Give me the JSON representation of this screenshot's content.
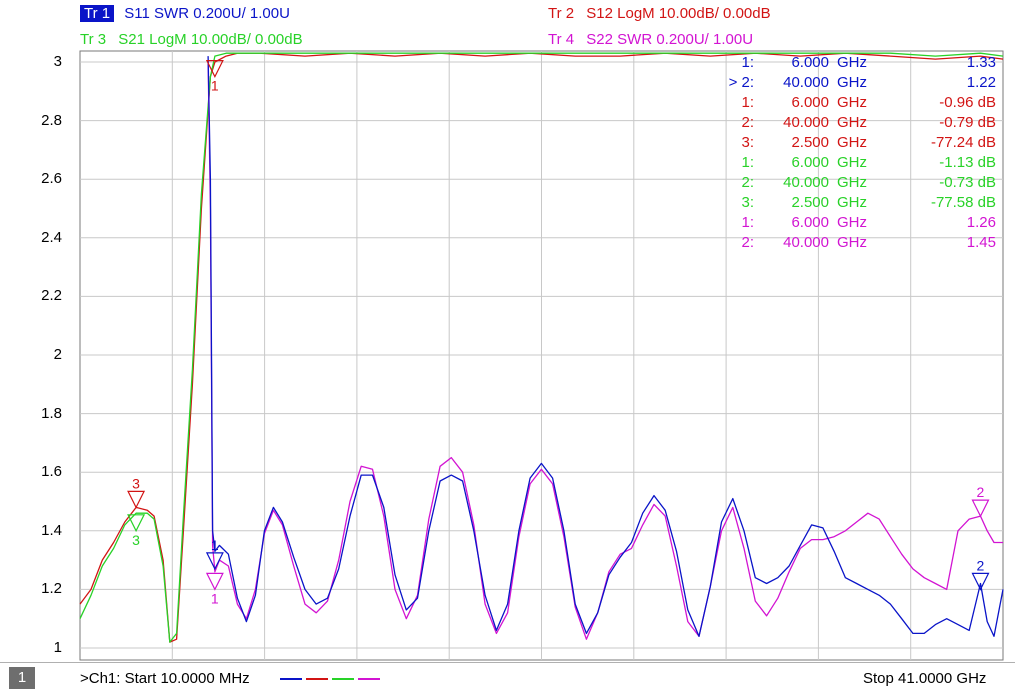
{
  "traces": [
    {
      "id": "tr1",
      "label": "Tr 1",
      "text": "S11 SWR 0.200U/  1.00U",
      "color": "#0a14c8"
    },
    {
      "id": "tr2",
      "label": "Tr 2",
      "text": "S12 LogM 10.00dB/  0.00dB",
      "color": "#d21414"
    },
    {
      "id": "tr3",
      "label": "Tr 3",
      "text": "S21 LogM 10.00dB/  0.00dB",
      "color": "#28d228"
    },
    {
      "id": "tr4",
      "label": "Tr 4",
      "text": "S22 SWR 0.200U/  1.00U",
      "color": "#d214d2"
    }
  ],
  "markers": [
    {
      "prefix": "1:",
      "freq": "6.000",
      "unit": "GHz",
      "value": "1.33",
      "color": "#0a14c8"
    },
    {
      "prefix": "> 2:",
      "freq": "40.000",
      "unit": "GHz",
      "value": "1.22",
      "color": "#0a14c8"
    },
    {
      "prefix": "1:",
      "freq": "6.000",
      "unit": "GHz",
      "value": "-0.96 dB",
      "color": "#d21414"
    },
    {
      "prefix": "2:",
      "freq": "40.000",
      "unit": "GHz",
      "value": "-0.79 dB",
      "color": "#d21414"
    },
    {
      "prefix": "3:",
      "freq": "2.500",
      "unit": "GHz",
      "value": "-77.24 dB",
      "color": "#d21414"
    },
    {
      "prefix": "1:",
      "freq": "6.000",
      "unit": "GHz",
      "value": "-1.13 dB",
      "color": "#28d228"
    },
    {
      "prefix": "2:",
      "freq": "40.000",
      "unit": "GHz",
      "value": "-0.73 dB",
      "color": "#28d228"
    },
    {
      "prefix": "3:",
      "freq": "2.500",
      "unit": "GHz",
      "value": "-77.58 dB",
      "color": "#28d228"
    },
    {
      "prefix": "1:",
      "freq": "6.000",
      "unit": "GHz",
      "value": "1.26",
      "color": "#d214d2"
    },
    {
      "prefix": "2:",
      "freq": "40.000",
      "unit": "GHz",
      "value": "1.45",
      "color": "#d214d2"
    }
  ],
  "footer": {
    "channel": "1",
    "start_text": ">Ch1:  Start   10.0000 MHz",
    "stop_text": "Stop  41.0000 GHz",
    "swatch_colors": [
      "#0a14c8",
      "#d21414",
      "#28d228",
      "#d214d2"
    ]
  },
  "chart_data": {
    "type": "line",
    "xlabel": "",
    "ylabel": "",
    "xlim": [
      0.01,
      41.0
    ],
    "ylim": [
      1,
      3
    ],
    "yticks": [
      3,
      2.8,
      2.6,
      2.4,
      2.2,
      2,
      1.8,
      1.6,
      1.4,
      1.2,
      1
    ],
    "ytick_labels": [
      "3",
      "2.8",
      "2.6",
      "2.4",
      "2.2",
      "2",
      "1.8",
      "1.6",
      "1.4",
      "1.2",
      "1"
    ],
    "grid": true,
    "series": [
      {
        "name": "S11 SWR",
        "color": "#0a14c8",
        "x": [
          5.7,
          5.8,
          5.9,
          6.0,
          6.2,
          6.6,
          7.0,
          7.4,
          7.8,
          8.2,
          8.6,
          9.0,
          9.5,
          10,
          10.5,
          11,
          11.5,
          12,
          12.5,
          13,
          13.5,
          14,
          14.5,
          15,
          15.5,
          16,
          16.5,
          17,
          17.5,
          18,
          18.5,
          19,
          19.5,
          20,
          20.5,
          21,
          21.5,
          22,
          22.5,
          23,
          23.5,
          24,
          24.5,
          25,
          25.5,
          26,
          26.5,
          27,
          27.5,
          28,
          28.5,
          29,
          29.5,
          30,
          30.5,
          31,
          31.5,
          32,
          32.5,
          33,
          33.5,
          34,
          34.5,
          35,
          35.5,
          36,
          36.5,
          37,
          37.5,
          38,
          38.5,
          39,
          39.5,
          40,
          40.3,
          40.6,
          41
        ],
        "y": [
          3.02,
          2.6,
          1.4,
          1.33,
          1.35,
          1.32,
          1.17,
          1.09,
          1.18,
          1.4,
          1.48,
          1.43,
          1.31,
          1.2,
          1.15,
          1.17,
          1.27,
          1.45,
          1.59,
          1.59,
          1.48,
          1.25,
          1.13,
          1.17,
          1.4,
          1.57,
          1.59,
          1.57,
          1.4,
          1.18,
          1.06,
          1.15,
          1.4,
          1.58,
          1.63,
          1.58,
          1.4,
          1.15,
          1.05,
          1.12,
          1.25,
          1.31,
          1.36,
          1.46,
          1.52,
          1.47,
          1.33,
          1.13,
          1.04,
          1.21,
          1.43,
          1.51,
          1.4,
          1.24,
          1.22,
          1.24,
          1.28,
          1.35,
          1.42,
          1.41,
          1.33,
          1.24,
          1.22,
          1.2,
          1.18,
          1.15,
          1.1,
          1.05,
          1.05,
          1.08,
          1.1,
          1.08,
          1.06,
          1.22,
          1.09,
          1.04,
          1.2
        ]
      },
      {
        "name": "S22 SWR",
        "color": "#d214d2",
        "x": [
          5.7,
          5.8,
          5.9,
          6.0,
          6.2,
          6.6,
          7.0,
          7.4,
          7.8,
          8.2,
          8.6,
          9.0,
          9.5,
          10,
          10.5,
          11,
          11.5,
          12,
          12.5,
          13,
          13.5,
          14,
          14.5,
          15,
          15.5,
          16,
          16.5,
          17,
          17.5,
          18,
          18.5,
          19,
          19.5,
          20,
          20.5,
          21,
          21.5,
          22,
          22.5,
          23,
          23.5,
          24,
          24.5,
          25,
          25.5,
          26,
          26.5,
          27,
          27.5,
          28,
          28.5,
          29,
          29.5,
          30,
          30.5,
          31,
          31.5,
          32,
          32.5,
          33,
          33.5,
          34,
          34.5,
          35,
          35.5,
          36,
          36.5,
          37,
          37.5,
          38,
          38.5,
          39,
          39.5,
          40,
          40.3,
          40.6,
          41
        ],
        "y": [
          3.0,
          2.5,
          1.35,
          1.26,
          1.3,
          1.28,
          1.15,
          1.1,
          1.2,
          1.39,
          1.47,
          1.42,
          1.28,
          1.15,
          1.12,
          1.16,
          1.3,
          1.5,
          1.62,
          1.61,
          1.45,
          1.2,
          1.1,
          1.18,
          1.44,
          1.62,
          1.65,
          1.6,
          1.42,
          1.15,
          1.05,
          1.12,
          1.38,
          1.56,
          1.61,
          1.56,
          1.38,
          1.14,
          1.03,
          1.12,
          1.26,
          1.32,
          1.34,
          1.42,
          1.49,
          1.45,
          1.28,
          1.09,
          1.04,
          1.21,
          1.4,
          1.48,
          1.34,
          1.16,
          1.11,
          1.17,
          1.26,
          1.34,
          1.37,
          1.37,
          1.38,
          1.4,
          1.43,
          1.46,
          1.44,
          1.38,
          1.32,
          1.27,
          1.24,
          1.22,
          1.2,
          1.4,
          1.44,
          1.45,
          1.4,
          1.36,
          1.36
        ]
      },
      {
        "name": "S12 LogM",
        "color": "#d21414",
        "x": [
          0.01,
          0.5,
          1.0,
          1.5,
          2.0,
          2.5,
          3.0,
          3.3,
          3.7,
          4.0,
          4.3,
          4.6,
          5.0,
          5.4,
          5.8,
          6.0,
          6.5,
          7,
          8,
          10,
          12,
          14,
          16,
          18,
          20,
          22,
          24,
          26,
          28,
          30,
          32,
          34,
          36,
          38,
          40,
          41
        ],
        "y": [
          1.15,
          1.2,
          1.3,
          1.36,
          1.43,
          1.48,
          1.47,
          1.45,
          1.3,
          1.02,
          1.03,
          1.4,
          1.9,
          2.5,
          2.95,
          3.0,
          3.02,
          3.03,
          3.03,
          3.02,
          3.03,
          3.02,
          3.03,
          3.02,
          3.03,
          3.02,
          3.02,
          3.03,
          3.02,
          3.03,
          3.02,
          3.03,
          3.02,
          3.01,
          3.02,
          3.01
        ]
      },
      {
        "name": "S21 LogM",
        "color": "#28d228",
        "x": [
          0.01,
          0.5,
          1.0,
          1.5,
          2.0,
          2.5,
          3.0,
          3.3,
          3.7,
          4.0,
          4.3,
          4.6,
          5.0,
          5.4,
          5.8,
          6.0,
          6.5,
          7,
          8,
          10,
          12,
          14,
          16,
          18,
          20,
          22,
          24,
          26,
          28,
          30,
          32,
          34,
          36,
          38,
          40,
          41
        ],
        "y": [
          1.1,
          1.18,
          1.28,
          1.34,
          1.42,
          1.46,
          1.46,
          1.44,
          1.28,
          1.02,
          1.05,
          1.45,
          1.95,
          2.55,
          2.95,
          3.02,
          3.03,
          3.03,
          3.03,
          3.03,
          3.03,
          3.03,
          3.03,
          3.03,
          3.03,
          3.03,
          3.03,
          3.03,
          3.03,
          3.03,
          3.03,
          3.03,
          3.03,
          3.02,
          3.03,
          3.02
        ]
      }
    ]
  }
}
